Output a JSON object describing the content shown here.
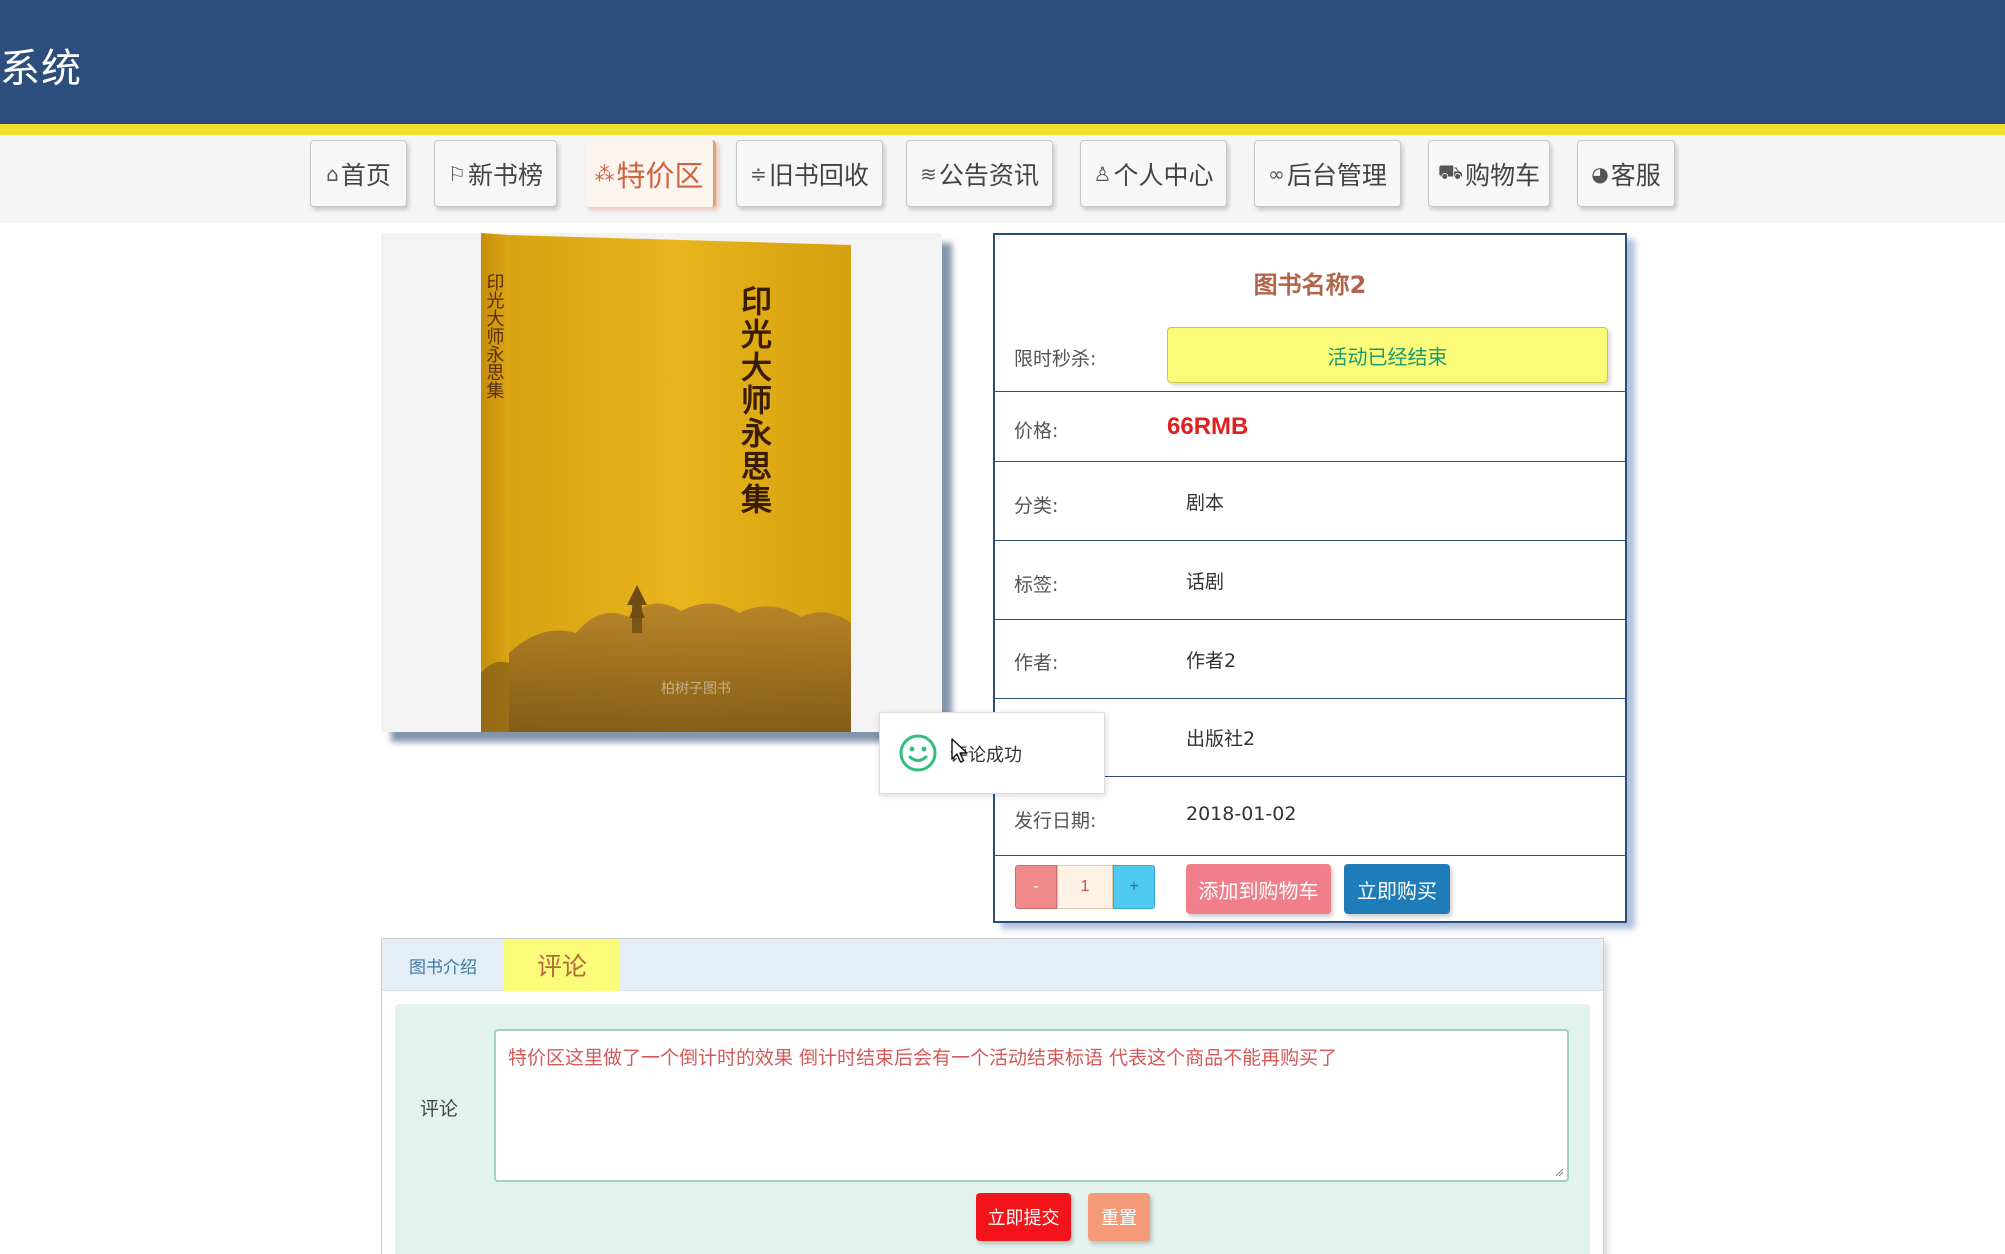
{
  "header": {
    "title": "系统"
  },
  "nav": [
    {
      "label": "首页",
      "icon": "home-icon",
      "glyph": "⌂",
      "active": false
    },
    {
      "label": "新书榜",
      "icon": "flag-icon",
      "glyph": "⚐",
      "active": false
    },
    {
      "label": "特价区",
      "icon": "grid-icon",
      "glyph": "⁂",
      "active": true
    },
    {
      "label": "旧书回收",
      "icon": "sliders-icon",
      "glyph": "≑",
      "active": false
    },
    {
      "label": "公告资讯",
      "icon": "layers-icon",
      "glyph": "≋",
      "active": false
    },
    {
      "label": "个人中心",
      "icon": "user-icon",
      "glyph": "♙",
      "active": false
    },
    {
      "label": "后台管理",
      "icon": "link-icon",
      "glyph": "∞",
      "active": false
    },
    {
      "label": "购物车",
      "icon": "cart-icon",
      "glyph": "⛟",
      "active": false
    },
    {
      "label": "客服",
      "icon": "support-icon",
      "glyph": "◕",
      "active": false
    }
  ],
  "cover": {
    "title": "印光大师永思集",
    "spine_title": "印光大师永思集",
    "watermark": "柏树子图书"
  },
  "book": {
    "title": "图书名称2",
    "flash_label": "限时秒杀:",
    "flash_status": "活动已经结束",
    "price_label": "价格:",
    "price": "66RMB",
    "category_label": "分类:",
    "category": "剧本",
    "tag_label": "标签:",
    "tag": "话剧",
    "author_label": "作者:",
    "author": "作者2",
    "publisher": "出版社2",
    "date_label": "发行日期:",
    "date": "2018-01-02"
  },
  "purchase": {
    "minus": "-",
    "quantity": "1",
    "plus": "+",
    "add_to_cart": "添加到购物车",
    "buy_now": "立即购买"
  },
  "toast": {
    "message": "评论成功"
  },
  "tabs": {
    "intro": "图书介绍",
    "review": "评论"
  },
  "review_form": {
    "label": "评论",
    "content": "特价区这里做了一个倒计时的效果  倒计时结束后会有一个活动结束标语  代表这个商品不能再购买了",
    "submit": "立即提交",
    "reset": "重置"
  },
  "colors": {
    "header": "#2c4e7c",
    "stripe": "#f0e12e",
    "active_nav": "#d0643c",
    "price": "#e0201e",
    "flash_bg": "#fbfb7a"
  }
}
